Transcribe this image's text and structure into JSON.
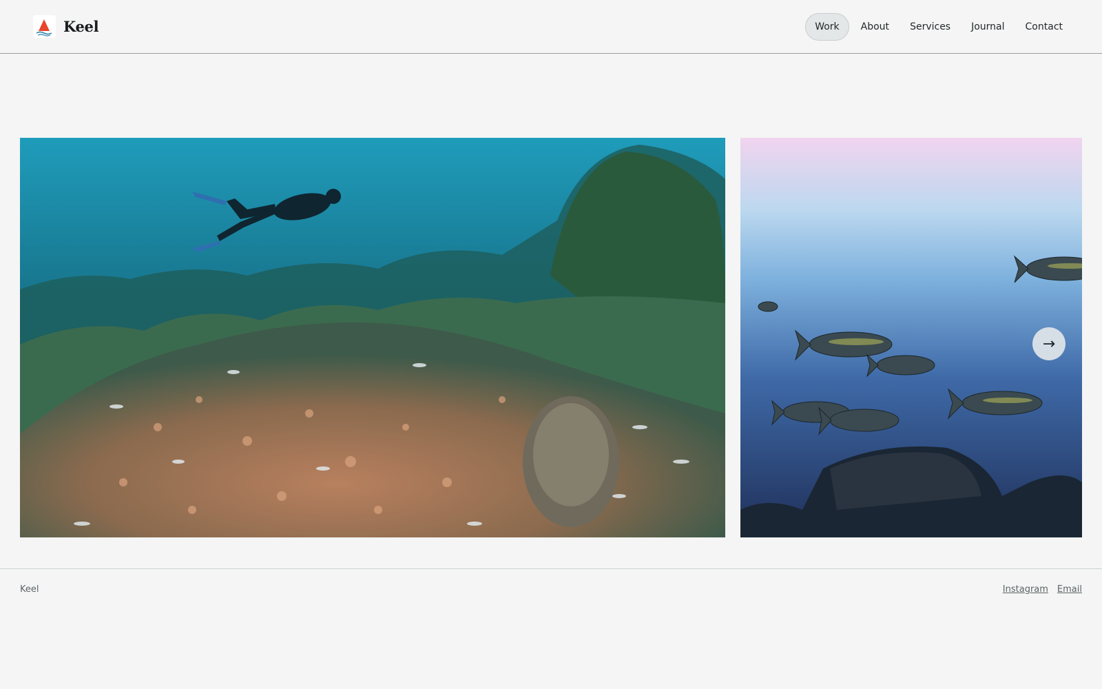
{
  "brand": {
    "name": "Keel",
    "logo_icon": "sailboat-logo-icon"
  },
  "nav": {
    "items": [
      {
        "label": "Work",
        "active": true
      },
      {
        "label": "About",
        "active": false
      },
      {
        "label": "Services",
        "active": false
      },
      {
        "label": "Journal",
        "active": false
      },
      {
        "label": "Contact",
        "active": false
      }
    ]
  },
  "gallery": {
    "photos": [
      {
        "subject": "scuba diver over coral reef"
      },
      {
        "subject": "school of jackfish underwater"
      }
    ],
    "next_button": {
      "label": "→",
      "icon": "arrow-right-icon"
    }
  },
  "footer": {
    "brand": "Keel",
    "links": [
      "Instagram",
      "Email"
    ]
  },
  "colors": {
    "background": "#f4f5f4",
    "accent": "#e8452c",
    "nav_active_bg": "#e4e7e8"
  }
}
